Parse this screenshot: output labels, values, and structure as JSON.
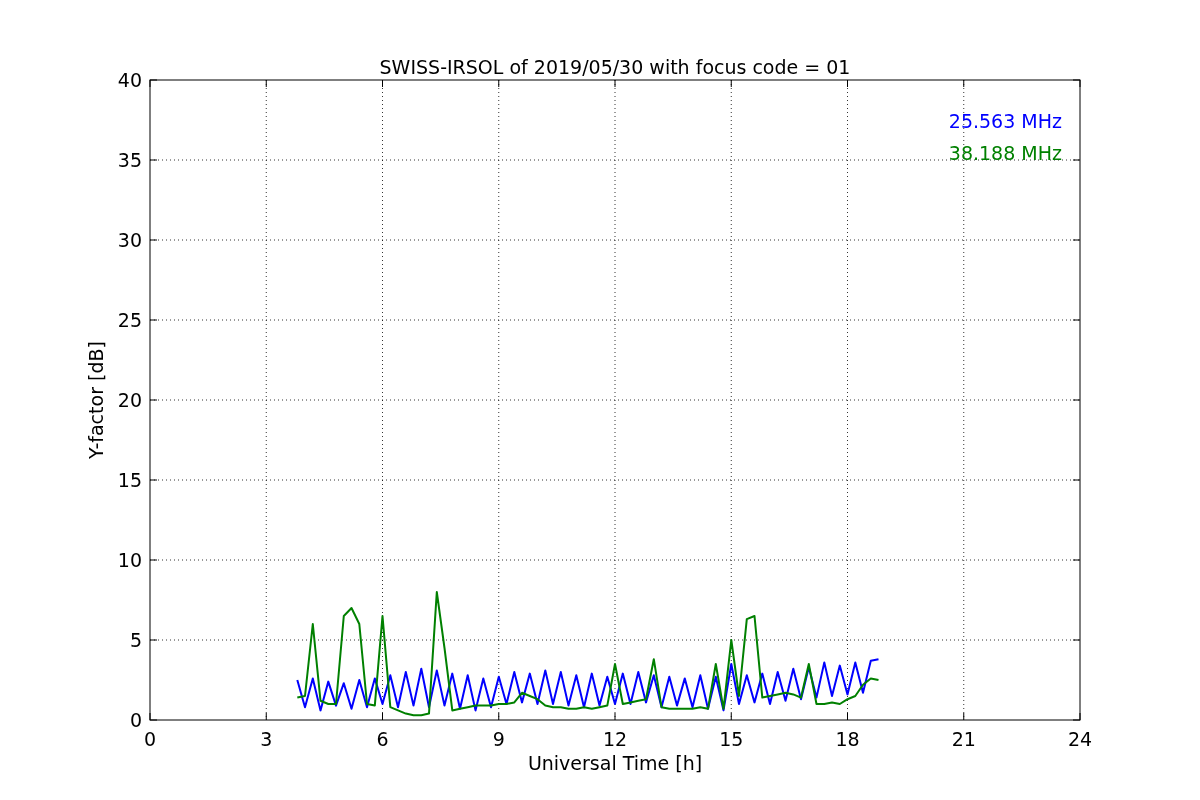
{
  "figure": {
    "chart_data": {
      "type": "line",
      "title": "SWISS-IRSOL of 2019/05/30 with focus code = 01",
      "xlabel": "Universal Time [h]",
      "ylabel": "Y-factor [dB]",
      "xlim": [
        0,
        24
      ],
      "ylim": [
        0,
        40
      ],
      "xticks": [
        0,
        3,
        6,
        9,
        12,
        15,
        18,
        21,
        24
      ],
      "yticks": [
        0,
        5,
        10,
        15,
        20,
        25,
        30,
        35,
        40
      ],
      "grid": true,
      "x": [
        3.8,
        4.0,
        4.2,
        4.4,
        4.6,
        4.8,
        5.0,
        5.2,
        5.4,
        5.6,
        5.8,
        6.0,
        6.2,
        6.4,
        6.6,
        6.8,
        7.0,
        7.2,
        7.4,
        7.6,
        7.8,
        8.0,
        8.2,
        8.4,
        8.6,
        8.8,
        9.0,
        9.2,
        9.4,
        9.6,
        9.8,
        10.0,
        10.2,
        10.4,
        10.6,
        10.8,
        11.0,
        11.2,
        11.4,
        11.6,
        11.8,
        12.0,
        12.2,
        12.4,
        12.6,
        12.8,
        13.0,
        13.2,
        13.4,
        13.6,
        13.8,
        14.0,
        14.2,
        14.4,
        14.6,
        14.8,
        15.0,
        15.2,
        15.4,
        15.6,
        15.8,
        16.0,
        16.2,
        16.4,
        16.6,
        16.8,
        17.0,
        17.2,
        17.4,
        17.6,
        17.8,
        18.0,
        18.2,
        18.4,
        18.6,
        18.8
      ],
      "series": [
        {
          "name": "25.563 MHz",
          "color": "#0000ff",
          "values": [
            2.5,
            0.8,
            2.6,
            0.6,
            2.4,
            0.9,
            2.3,
            0.7,
            2.5,
            0.8,
            2.6,
            1.0,
            2.8,
            0.8,
            3.0,
            0.9,
            3.2,
            0.8,
            3.1,
            0.9,
            2.9,
            0.7,
            2.8,
            0.6,
            2.6,
            0.8,
            2.7,
            1.0,
            3.0,
            1.1,
            2.9,
            1.0,
            3.1,
            1.0,
            3.0,
            0.9,
            2.8,
            0.8,
            2.9,
            0.9,
            2.7,
            1.0,
            2.9,
            1.0,
            3.0,
            1.1,
            2.8,
            0.8,
            2.7,
            0.9,
            2.6,
            0.8,
            2.8,
            0.7,
            2.7,
            0.6,
            3.5,
            1.0,
            2.8,
            1.1,
            2.9,
            1.0,
            3.0,
            1.2,
            3.2,
            1.3,
            3.3,
            1.4,
            3.6,
            1.5,
            3.4,
            1.6,
            3.6,
            1.7,
            3.7,
            3.8
          ]
        },
        {
          "name": "38.188 MHz",
          "color": "#008000",
          "values": [
            1.4,
            1.5,
            6.0,
            1.2,
            1.0,
            1.0,
            6.5,
            7.0,
            6.0,
            1.0,
            0.9,
            6.5,
            0.8,
            0.6,
            0.4,
            0.3,
            0.3,
            0.4,
            8.0,
            4.5,
            0.6,
            0.7,
            0.8,
            0.9,
            0.9,
            0.9,
            1.0,
            1.0,
            1.1,
            1.7,
            1.5,
            1.3,
            0.9,
            0.8,
            0.8,
            0.7,
            0.7,
            0.8,
            0.7,
            0.8,
            0.9,
            3.5,
            1.0,
            1.1,
            1.2,
            1.3,
            3.8,
            0.8,
            0.7,
            0.7,
            0.7,
            0.7,
            0.8,
            0.7,
            3.5,
            0.7,
            5.0,
            1.5,
            6.3,
            6.5,
            1.4,
            1.5,
            1.6,
            1.7,
            1.6,
            1.4,
            3.5,
            1.0,
            1.0,
            1.1,
            1.0,
            1.3,
            1.5,
            2.2,
            2.6,
            2.5
          ]
        }
      ]
    }
  }
}
